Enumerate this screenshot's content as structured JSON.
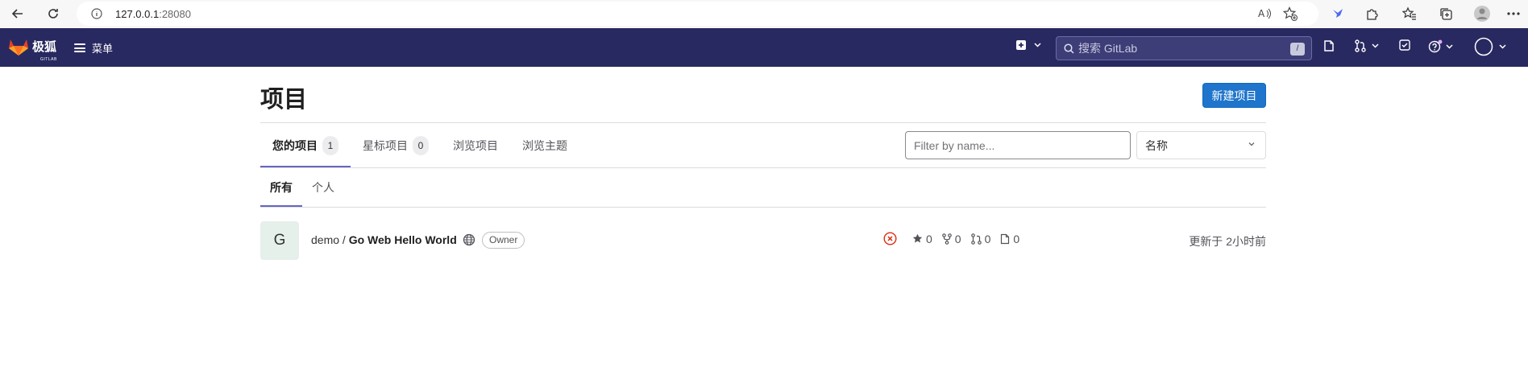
{
  "browser": {
    "url_host": "127.0.0.1",
    "url_port": ":28080"
  },
  "header": {
    "logo_text": "极狐",
    "logo_sub": "GITLAB",
    "menu_label": "菜单",
    "search_placeholder": "搜索 GitLab",
    "search_shortcut": "/"
  },
  "page": {
    "title": "项目",
    "new_project_label": "新建项目"
  },
  "tabs": [
    {
      "label": "您的项目",
      "count": "1"
    },
    {
      "label": "星标项目",
      "count": "0"
    },
    {
      "label": "浏览项目"
    },
    {
      "label": "浏览主题"
    }
  ],
  "filter": {
    "placeholder": "Filter by name...",
    "sort_selected": "名称"
  },
  "subtabs": [
    {
      "label": "所有"
    },
    {
      "label": "个人"
    }
  ],
  "project": {
    "avatar_letter": "G",
    "namespace": "demo / ",
    "name": "Go Web Hello World",
    "role": "Owner",
    "stars": "0",
    "forks": "0",
    "merge_requests": "0",
    "issues": "0",
    "updated": "更新于 2小时前"
  },
  "colors": {
    "header_bg": "#292961",
    "primary_button": "#1f75cb",
    "active_tab_underline": "#6666c4",
    "pipeline_failed": "#dd2b0e"
  }
}
